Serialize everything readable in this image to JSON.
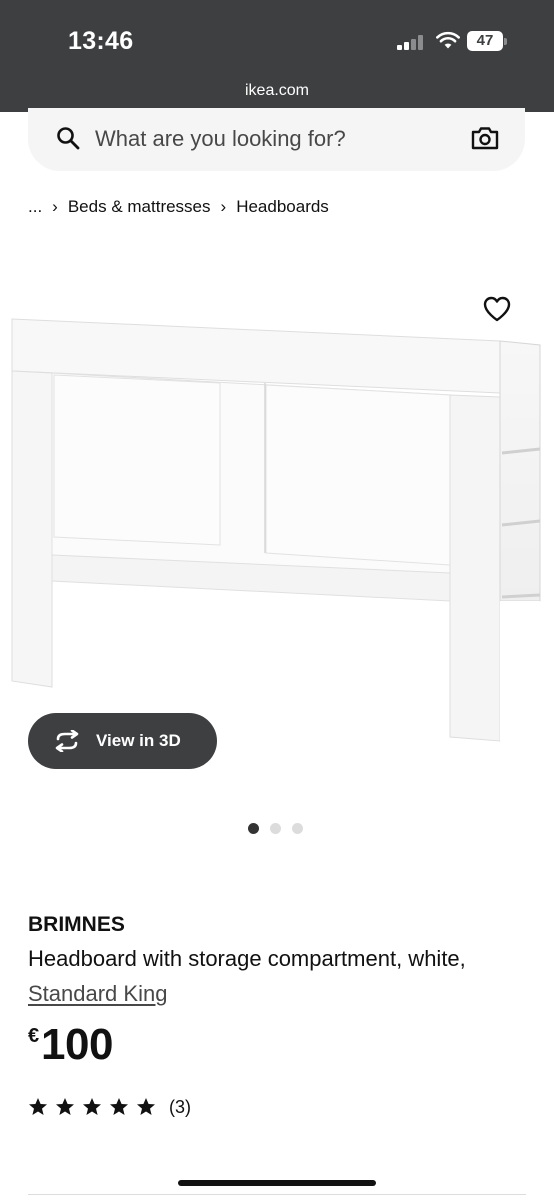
{
  "status_bar": {
    "time": "13:46",
    "battery": "47",
    "icons": [
      "cellular-signal-icon",
      "wifi-icon",
      "battery-icon"
    ]
  },
  "browser": {
    "url": "ikea.com"
  },
  "search": {
    "placeholder": "What are you looking for?",
    "icons": [
      "search-icon",
      "camera-icon"
    ]
  },
  "breadcrumb": {
    "items": [
      "...",
      "Beds & mattresses",
      "Headboards"
    ],
    "separator_icon": "chevron-right-icon"
  },
  "gallery": {
    "favourite_icon": "heart-outline-icon",
    "view_3d_label": "View in 3D",
    "view_3d_icon": "rotate-arrows-icon",
    "dots_total": 3,
    "active_dot": 1
  },
  "product": {
    "name": "BRIMNES",
    "description": "Headboard with storage compartment, white,",
    "variant": "Standard King",
    "currency": "€",
    "price": "100",
    "rating": 5,
    "review_count": "(3)"
  },
  "colors": {
    "header_bg": "#3d3f40",
    "search_bg": "#f5f5f5",
    "text": "#111111",
    "inactive_dot": "#dcdcdc",
    "active_dot": "#333333"
  }
}
